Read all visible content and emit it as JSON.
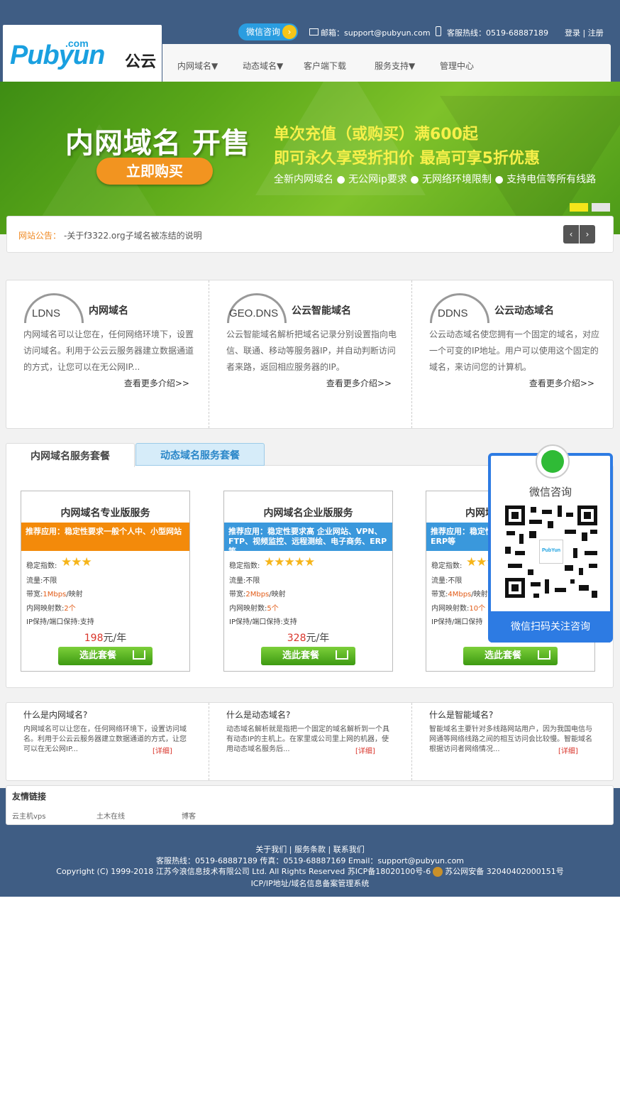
{
  "header": {
    "logo_text": "Pubyun",
    "logo_com": ".com",
    "logo_cn": "公云",
    "wechat_btn": "微信咨询",
    "email": "邮箱：support@pubyun.com",
    "hotline": "客服热线：0519-68887189",
    "login": "登录 | 注册"
  },
  "nav": {
    "items": [
      "内网域名▼",
      "动态域名▼",
      "客户端下载",
      "服务支持▼",
      "管理中心"
    ]
  },
  "banner": {
    "title": "内网域名 开售",
    "buy_button": "立即购买",
    "line1": "单次充值（或购买）满600起",
    "line2": "即可永久享受折扣价 最高可享5折优惠",
    "line3": "全新内网域名 ● 无公网ip要求 ● 无网络环境限制 ● 支持电信等所有线路"
  },
  "notice": {
    "label": "网站公告：",
    "text": "-关于f3322.org子域名被冻结的说明",
    "prev": "‹",
    "next": "›"
  },
  "features": [
    {
      "logo": "LDNS",
      "title": "内网域名",
      "desc": "内网域名可以让您在，任何网络环境下，设置访问域名。利用于公云云服务器建立数据通道的方式，让您可以在无公网IP...",
      "more": "查看更多介绍>>"
    },
    {
      "logo": "GEO.DNS",
      "title": "公云智能域名",
      "desc": "公云智能域名解析把域名记录分别设置指向电信、联通、移动等服务器IP，并自动判断访问者来路，返回相应服务器的IP。",
      "more": "查看更多介绍>>"
    },
    {
      "logo": "DDNS",
      "title": "公云动态域名",
      "desc": "公云动态域名使您拥有一个固定的域名，对应一个可变的IP地址。用户可以使用这个固定的域名，来访问您的计算机。",
      "more": "查看更多介绍>>"
    }
  ],
  "tabs": [
    "内网域名服务套餐",
    "动态域名服务套餐"
  ],
  "packages": [
    {
      "title": "内网域名专业版服务",
      "recommend": "推荐应用：稳定性要求一般个人中、小型网站",
      "stars": 3,
      "stability": "稳定指数:",
      "traffic": "流量:",
      "traffic_val": "不限",
      "bandwidth": "带宽:",
      "bandwidth_val": "1Mbps",
      "bandwidth_unit": "/映射",
      "maps": "内网映射数:",
      "maps_val": "2个",
      "ip": "IP保持/端口保持:支持",
      "price": "198",
      "price_unit": "元/年",
      "button": "选此套餐"
    },
    {
      "title": "内网域名企业版服务",
      "recommend": "推荐应用：稳定性要求高 企业网站、VPN、FTP、视频监控、远程测绘、电子商务、ERP等",
      "stars": 5,
      "stability": "稳定指数:",
      "traffic": "流量:",
      "traffic_val": "不限",
      "bandwidth": "带宽:",
      "bandwidth_val": "2Mbps",
      "bandwidth_unit": "/映射",
      "maps": "内网映射数:",
      "maps_val": "5个",
      "ip": "IP保持/端口保持:支持",
      "price": "328",
      "price_unit": "元/年",
      "button": "选此套餐"
    },
    {
      "title": "内网域名",
      "recommend": "推荐应用：稳定性 VPN、FTP、视频 等、ERP等",
      "stars": 3,
      "stability": "稳定指数:",
      "traffic": "流量:",
      "traffic_val": "不限",
      "bandwidth": "带宽:",
      "bandwidth_val": "4Mbps",
      "bandwidth_unit": "/映射",
      "maps": "内网映射数:",
      "maps_val": "10个",
      "ip": "IP保持/端口保持",
      "price": "",
      "price_unit": "",
      "button": "选此套餐"
    }
  ],
  "wechat_panel": {
    "title": "微信咨询",
    "footer": "微信扫码关注咨询",
    "qr_center": "PubYun"
  },
  "faq": [
    {
      "q": "什么是内网域名?",
      "a": "内网域名可以让您在，任何网络环境下，设置访问域名。利用于公云云服务器建立数据通道的方式，让您可以在无公网IP...",
      "more": "[详细]"
    },
    {
      "q": "什么是动态域名?",
      "a": "动态域名解析就是指把一个固定的域名解析到一个具有动态IP的主机上。在家里或公司里上网的机器，使用动态域名服务后...",
      "more": "[详细]"
    },
    {
      "q": "什么是智能域名?",
      "a": "智能域名主要针对多线路网站用户，因为我国电信与网通等网络线路之间的相互访问会比较慢。智能域名根据访问者网络情况...",
      "more": "[详细]"
    }
  ],
  "friend_links": {
    "title": "友情链接",
    "items": [
      "云主机vps",
      "土木在线",
      "博客"
    ]
  },
  "footer": {
    "links": "关于我们 | 服务条款 | 联系我们",
    "contact": "客服热线：0519-68887189   传真：0519-68887169   Email：support@pubyun.com",
    "copyright": "Copyright (C) 1999-2018 江苏今浪信息技术有限公司 Ltd. All Rights Reserved 苏ICP备18020100号-6",
    "police": "苏公网安备 32040402000151号",
    "icp": "ICP/IP地址/域名信息备案管理系统"
  },
  "colors": {
    "header_bg": "#3f5d84",
    "accent_blue": "#2d7be3",
    "banner_green": "#5aa719",
    "orange": "#f38a0a",
    "price_red": "#d9342a"
  }
}
